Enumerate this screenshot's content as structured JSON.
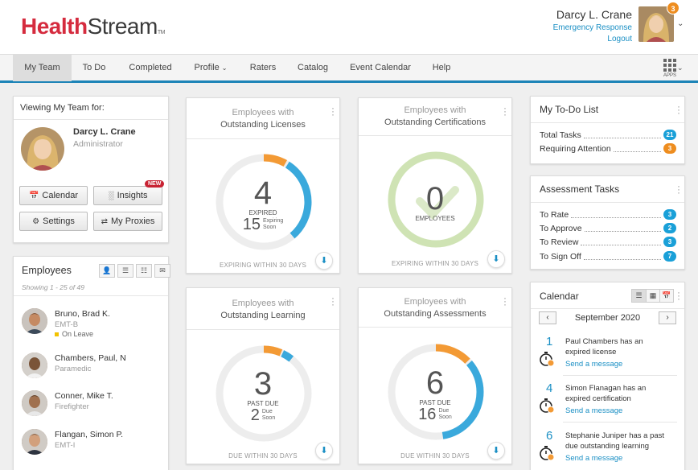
{
  "header": {
    "logo_part1": "Health",
    "logo_part2": "Stream",
    "logo_tm": "TM",
    "user_name": "Darcy L. Crane",
    "user_role": "Emergency Response",
    "logout": "Logout",
    "notification_count": "3"
  },
  "nav": {
    "items": [
      "My Team",
      "To Do",
      "Completed",
      "Profile",
      "Raters",
      "Catalog",
      "Event Calendar",
      "Help"
    ],
    "apps_label": "APPS"
  },
  "viewing": {
    "title": "Viewing My Team for:",
    "name": "Darcy L. Crane",
    "role": "Administrator",
    "buttons": {
      "calendar": "Calendar",
      "insights": "Insights",
      "settings": "Settings",
      "proxies": "My Proxies"
    },
    "new_badge": "NEW"
  },
  "employees": {
    "title": "Employees",
    "showing": "Showing 1 - 25 of 49",
    "list": [
      {
        "name": "Bruno, Brad K.",
        "role": "EMT-B",
        "status": "On Leave"
      },
      {
        "name": "Chambers, Paul, N",
        "role": "Paramedic"
      },
      {
        "name": "Conner, Mike T.",
        "role": "Firefighter"
      },
      {
        "name": "Flangan, Simon P.",
        "role": "EMT-I"
      }
    ]
  },
  "tiles": {
    "licenses": {
      "title1": "Employees with",
      "title2": "Outstanding Licenses",
      "big": "4",
      "big_label": "EXPIRED",
      "sub": "15",
      "sub_label1": "Expiring",
      "sub_label2": "Soon",
      "footer": "EXPIRING WITHIN 30 DAYS"
    },
    "certifications": {
      "title1": "Employees with",
      "title2": "Outstanding Certifications",
      "big": "0",
      "big_label": "EMPLOYEES",
      "footer": "EXPIRING WITHIN 30 DAYS"
    },
    "learning": {
      "title1": "Employees with",
      "title2": "Outstanding Learning",
      "big": "3",
      "big_label": "PAST DUE",
      "sub": "2",
      "sub_label1": "Due",
      "sub_label2": "Soon",
      "footer": "DUE WITHIN 30 DAYS"
    },
    "assessments": {
      "title1": "Employees with",
      "title2": "Outstanding Assessments",
      "big": "6",
      "big_label": "PAST DUE",
      "sub": "16",
      "sub_label1": "Due",
      "sub_label2": "Soon",
      "footer": "DUE WITHIN 30 DAYS"
    }
  },
  "todo": {
    "title": "My To-Do List",
    "rows": [
      {
        "label": "Total Tasks",
        "count": "21",
        "color": "#1aa0d8"
      },
      {
        "label": "Requiring Attention",
        "count": "3",
        "color": "#ee8d1f"
      }
    ]
  },
  "assessment": {
    "title": "Assessment Tasks",
    "rows": [
      {
        "label": "To Rate",
        "count": "3"
      },
      {
        "label": "To Approve",
        "count": "2"
      },
      {
        "label": "To Review",
        "count": "3"
      },
      {
        "label": "To Sign Off",
        "count": "7"
      }
    ]
  },
  "calendar": {
    "title": "Calendar",
    "month": "September 2020",
    "events": [
      {
        "day": "1",
        "line1": "Paul Chambers has an",
        "line2": "expired license",
        "link": "Send a message"
      },
      {
        "day": "4",
        "line1": "Simon Flanagan has an",
        "line2": "expired certification",
        "link": "Send a message"
      },
      {
        "day": "6",
        "line1": "Stephanie Juniper has a past",
        "line2": "due outstanding learning",
        "link": "Send a message"
      }
    ]
  },
  "colors": {
    "accent": "#1d84b7",
    "blue_ring": "#3aa9dc",
    "orange_ring": "#f39a35",
    "green_ring": "#cfe3b4",
    "brand_red": "#d52b3e"
  }
}
